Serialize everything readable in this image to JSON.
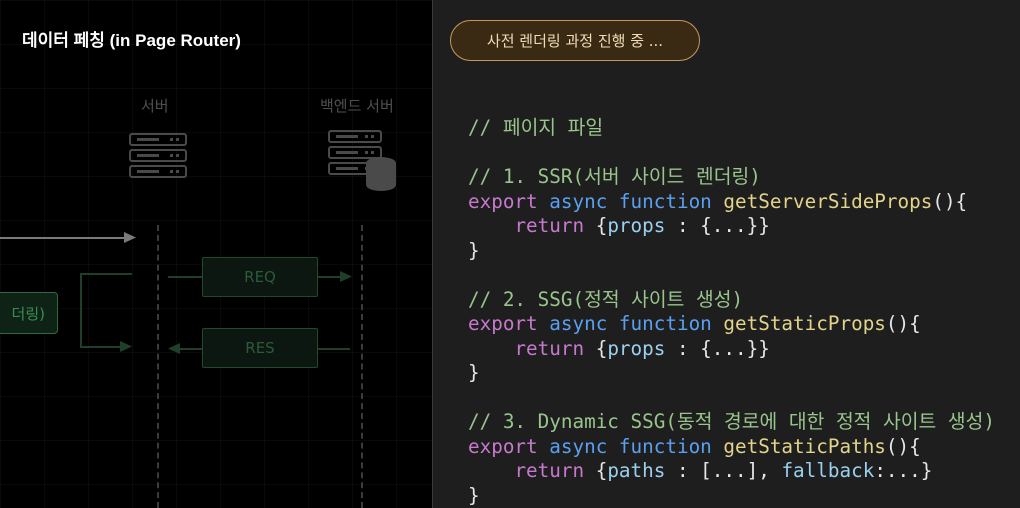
{
  "left": {
    "title": "데이터 페칭 (in Page Router)",
    "server_label": "서버",
    "backend_label": "백엔드 서버",
    "req_label": "REQ",
    "res_label": "RES",
    "render_label": "더링)"
  },
  "right": {
    "status_pill": "사전 렌더링 과정 진행 중 ...",
    "code_lines": [
      {
        "parts": [
          {
            "cls": "c",
            "text": "// 페이지 파일"
          }
        ]
      },
      {
        "parts": [
          {
            "cls": "t",
            "text": ""
          }
        ]
      },
      {
        "parts": [
          {
            "cls": "c",
            "text": "// 1. SSR(서버 사이드 렌더링)"
          }
        ]
      },
      {
        "parts": [
          {
            "cls": "k",
            "text": "export "
          },
          {
            "cls": "b",
            "text": "async function "
          },
          {
            "cls": "f",
            "text": "getServerSideProps"
          },
          {
            "cls": "t",
            "text": "(){"
          }
        ]
      },
      {
        "parts": [
          {
            "cls": "t",
            "text": "    "
          },
          {
            "cls": "k",
            "text": "return "
          },
          {
            "cls": "t",
            "text": "{"
          },
          {
            "cls": "p",
            "text": "props"
          },
          {
            "cls": "t",
            "text": " : {...}}"
          }
        ]
      },
      {
        "parts": [
          {
            "cls": "t",
            "text": "}"
          }
        ]
      },
      {
        "parts": [
          {
            "cls": "t",
            "text": ""
          }
        ]
      },
      {
        "parts": [
          {
            "cls": "c",
            "text": "// 2. SSG(정적 사이트 생성)"
          }
        ]
      },
      {
        "parts": [
          {
            "cls": "k",
            "text": "export "
          },
          {
            "cls": "b",
            "text": "async function "
          },
          {
            "cls": "f",
            "text": "getStaticProps"
          },
          {
            "cls": "t",
            "text": "(){"
          }
        ]
      },
      {
        "parts": [
          {
            "cls": "t",
            "text": "    "
          },
          {
            "cls": "k",
            "text": "return "
          },
          {
            "cls": "t",
            "text": "{"
          },
          {
            "cls": "p",
            "text": "props"
          },
          {
            "cls": "t",
            "text": " : {...}}"
          }
        ]
      },
      {
        "parts": [
          {
            "cls": "t",
            "text": "}"
          }
        ]
      },
      {
        "parts": [
          {
            "cls": "t",
            "text": ""
          }
        ]
      },
      {
        "parts": [
          {
            "cls": "c",
            "text": "// 3. Dynamic SSG(동적 경로에 대한 정적 사이트 생성)"
          }
        ]
      },
      {
        "parts": [
          {
            "cls": "k",
            "text": "export "
          },
          {
            "cls": "b",
            "text": "async function "
          },
          {
            "cls": "f",
            "text": "getStaticPaths"
          },
          {
            "cls": "t",
            "text": "(){"
          }
        ]
      },
      {
        "parts": [
          {
            "cls": "t",
            "text": "    "
          },
          {
            "cls": "k",
            "text": "return "
          },
          {
            "cls": "t",
            "text": "{"
          },
          {
            "cls": "p",
            "text": "paths"
          },
          {
            "cls": "t",
            "text": " : [...], "
          },
          {
            "cls": "p",
            "text": "fallback"
          },
          {
            "cls": "t",
            "text": ":...}"
          }
        ]
      },
      {
        "parts": [
          {
            "cls": "t",
            "text": "}"
          }
        ]
      }
    ]
  }
}
